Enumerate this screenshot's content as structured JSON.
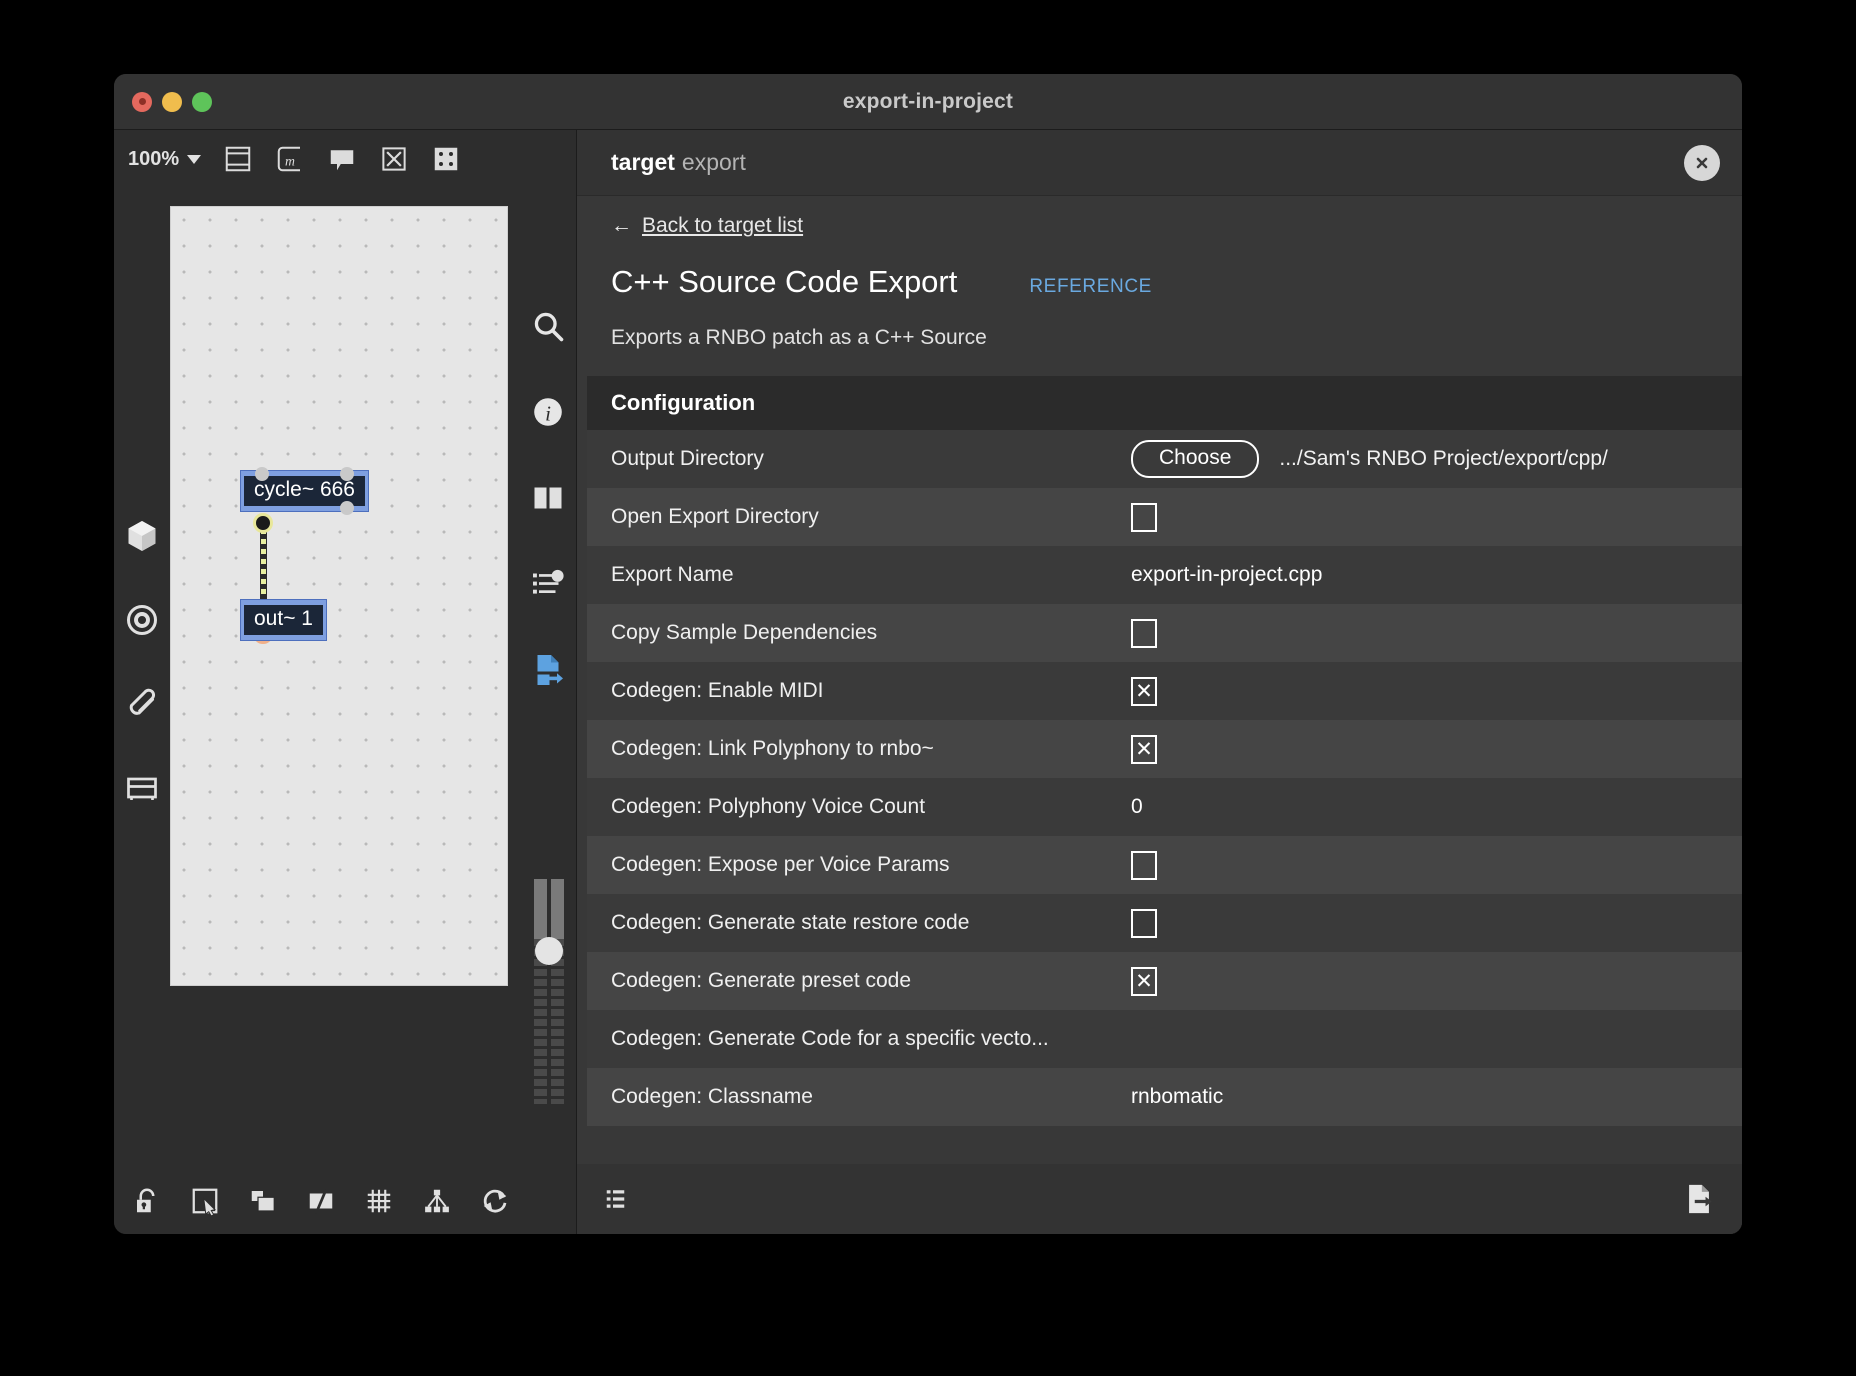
{
  "window": {
    "title": "export-in-project",
    "traffic_lights": [
      "close",
      "minimize",
      "zoom"
    ]
  },
  "patcher": {
    "zoom_level": "100%",
    "toolbar_icons": [
      "presentation-mode-icon",
      "max-object-icon",
      "comment-icon",
      "cancel-box-icon",
      "pattr-icon"
    ],
    "left_icons": [
      "cube-icon",
      "target-icon",
      "paperclip-icon",
      "drawer-icon"
    ],
    "right_icons": [
      "search-icon",
      "info-icon",
      "columns-icon",
      "parameters-icon",
      "export-icon"
    ],
    "bottom_icons": [
      "unlock-icon",
      "presentation-select-icon",
      "layers-icon",
      "split-icon",
      "grid-icon",
      "hierarchy-icon",
      "refresh-icon"
    ],
    "objects": [
      {
        "name": "cycle-object",
        "text": "cycle~ 666"
      },
      {
        "name": "out-object",
        "text": "out~ 1"
      }
    ]
  },
  "panel": {
    "header": {
      "label_bold": "target",
      "label_sub": "export",
      "close_icon": "close-icon"
    },
    "back_link": {
      "arrow": "←",
      "label": "Back to target list"
    },
    "export_title": "C++ Source Code Export",
    "reference_label": "REFERENCE",
    "description": "Exports a RNBO patch as a C++ Source",
    "config_section_title": "Configuration",
    "rows": [
      {
        "label": "Output Directory",
        "type": "path",
        "button": "Choose",
        "value": ".../Sam's RNBO Project/export/cpp/"
      },
      {
        "label": "Open Export Directory",
        "type": "checkbox",
        "checked": false
      },
      {
        "label": "Export Name",
        "type": "text",
        "value": "export-in-project.cpp"
      },
      {
        "label": "Copy Sample Dependencies",
        "type": "checkbox",
        "checked": false
      },
      {
        "label": "Codegen: Enable MIDI",
        "type": "checkbox",
        "checked": true
      },
      {
        "label": "Codegen: Link Polyphony to rnbo~",
        "type": "checkbox",
        "checked": true
      },
      {
        "label": "Codegen: Polyphony Voice Count",
        "type": "text",
        "value": "0"
      },
      {
        "label": "Codegen: Expose per Voice Params",
        "type": "checkbox",
        "checked": false
      },
      {
        "label": "Codegen: Generate state restore code",
        "type": "checkbox",
        "checked": false
      },
      {
        "label": "Codegen: Generate preset code",
        "type": "checkbox",
        "checked": true
      },
      {
        "label": "Codegen: Generate Code for a specific vecto...",
        "type": "none"
      },
      {
        "label": "Codegen: Classname",
        "type": "text",
        "value": "rnbomatic"
      }
    ],
    "bottom_icons": [
      "list-icon",
      "export-file-icon"
    ]
  },
  "checkbox_mark": "✕",
  "colors": {
    "accent_blue": "#6aa9e0",
    "panel_bg": "#383838",
    "row_odd": "#3a3a3a",
    "row_even": "#454545",
    "object_fill": "#1b2638",
    "object_select": "#7e9fe0"
  }
}
